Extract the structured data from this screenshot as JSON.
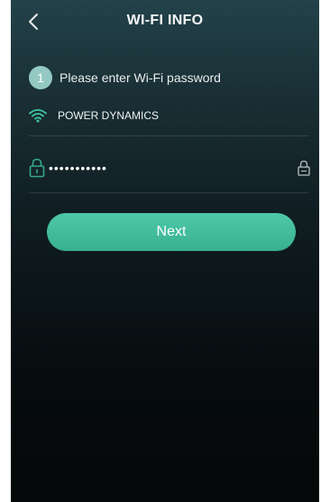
{
  "header": {
    "title": "WI-FI INFO",
    "back_icon": "chevron-left-icon"
  },
  "step": {
    "number": "1",
    "instruction": "Please enter Wi-Fi password"
  },
  "network": {
    "icon": "wifi-icon",
    "name": "POWER DYNAMICS"
  },
  "password": {
    "value": "•••••••••••",
    "lock_icon": "lock-icon",
    "toggle_icon": "lock-outline-icon"
  },
  "actions": {
    "next_label": "Next"
  },
  "colors": {
    "accent": "#3fbf9c",
    "step_badge": "#93c9c2",
    "wifi_icon": "#3fc59e",
    "lock_icon": "#37a887"
  }
}
